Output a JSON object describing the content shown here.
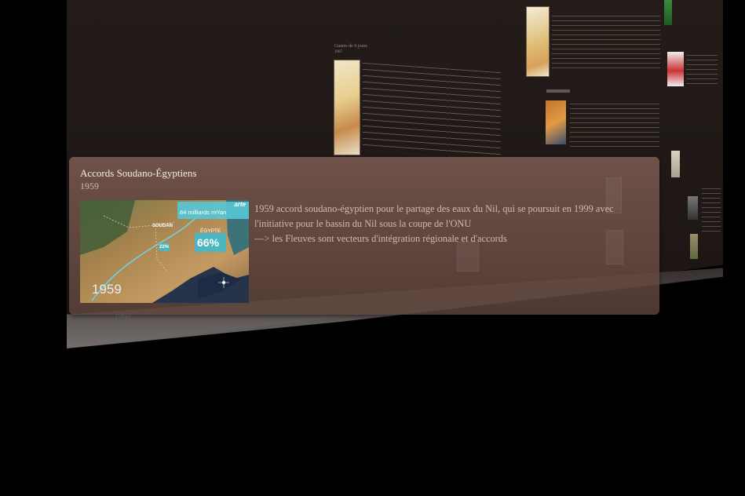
{
  "popup": {
    "title": "Accords Soudano-Égyptiens",
    "date": "1959",
    "description": "1959  accord soudano-égyptien pour le partage des eaux du Nil, qui se poursuit en 1999 avec l'initiative pour le bassin du Nil sous la coupe de l'ONU\n—> les Fleuves sont vecteurs d'intégration régionale et d'accords",
    "image": {
      "year": "1959",
      "channel": "arte",
      "flow": "84 milliards m³/an",
      "country_sudan": "SOUDAN",
      "country_egypt": "ÉGYPTE",
      "share_egypt": "66%",
      "share_sudan": "22%"
    }
  },
  "timeline": {
    "visible_tick": "1960"
  },
  "background": {
    "event_title": "Guerre de 6 jours",
    "event_date": "1967"
  }
}
